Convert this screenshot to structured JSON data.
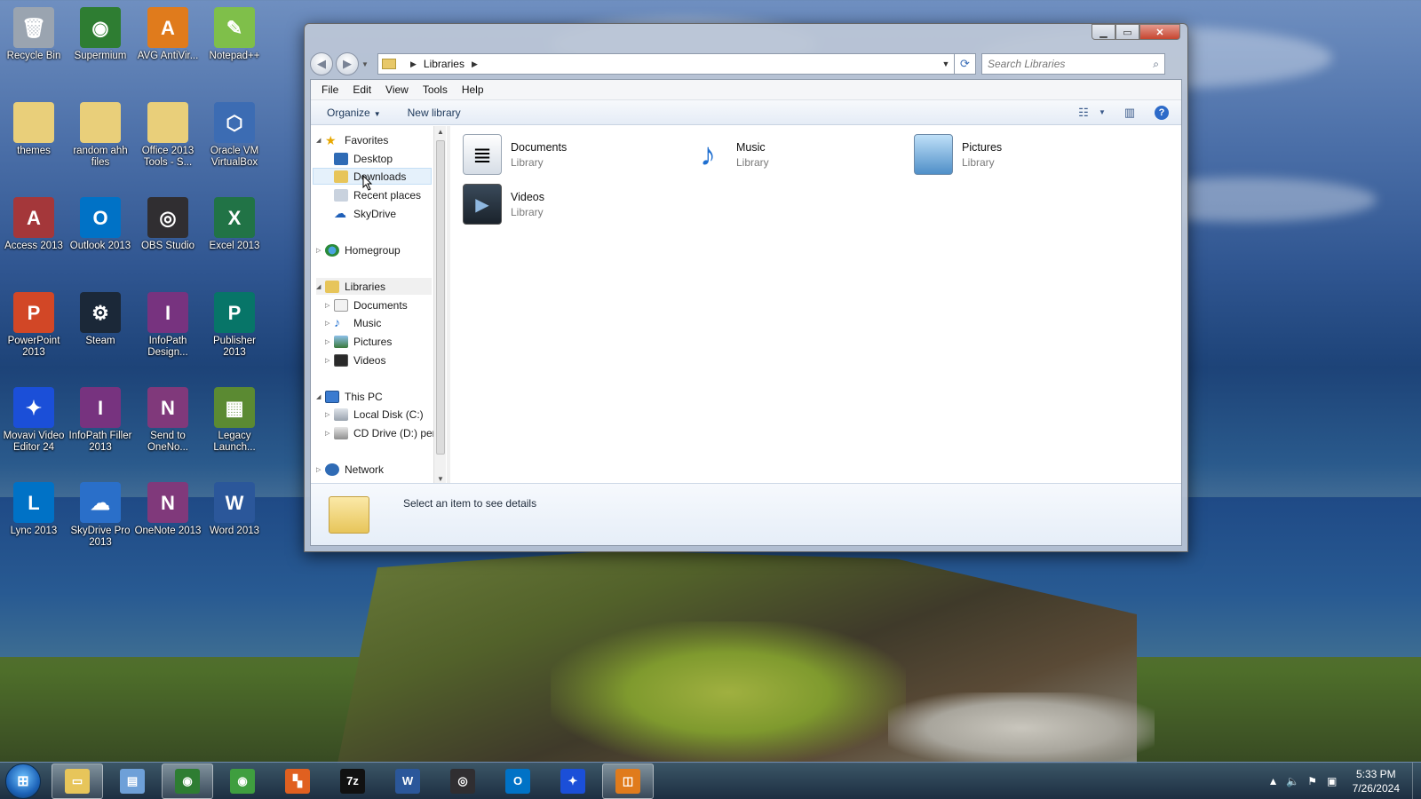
{
  "desktop": {
    "icons": [
      {
        "label": "Recycle Bin",
        "glyph": "🗑",
        "icon": "recycle-bin-icon",
        "color": "#9aa4b0"
      },
      {
        "label": "Supermium",
        "glyph": "◉",
        "icon": "browser-icon",
        "color": "#2e7d32"
      },
      {
        "label": "AVG AntiVir...",
        "glyph": "A",
        "icon": "antivirus-icon",
        "color": "#e07b1c"
      },
      {
        "label": "Notepad++",
        "glyph": "✎",
        "icon": "notepad-icon",
        "color": "#7fbf4a"
      },
      {
        "label": "themes",
        "glyph": "",
        "icon": "folder-icon",
        "color": "#e9cf7a"
      },
      {
        "label": "random ahh files",
        "glyph": "",
        "icon": "folder-icon",
        "color": "#e9cf7a"
      },
      {
        "label": "Office 2013 Tools - S...",
        "glyph": "",
        "icon": "folder-icon",
        "color": "#e9cf7a"
      },
      {
        "label": "Oracle VM VirtualBox",
        "glyph": "⬡",
        "icon": "virtualbox-icon",
        "color": "#3c6cb3"
      },
      {
        "label": "Access 2013",
        "glyph": "A",
        "icon": "access-icon",
        "color": "#a4373a"
      },
      {
        "label": "Outlook 2013",
        "glyph": "O",
        "icon": "outlook-icon",
        "color": "#0072c6"
      },
      {
        "label": "OBS Studio",
        "glyph": "◎",
        "icon": "obs-icon",
        "color": "#302e31"
      },
      {
        "label": "Excel 2013",
        "glyph": "X",
        "icon": "excel-icon",
        "color": "#217346"
      },
      {
        "label": "PowerPoint 2013",
        "glyph": "P",
        "icon": "powerpoint-icon",
        "color": "#d24726"
      },
      {
        "label": "Steam",
        "glyph": "⚙",
        "icon": "steam-icon",
        "color": "#1b2838"
      },
      {
        "label": "InfoPath Design...",
        "glyph": "I",
        "icon": "infopath-icon",
        "color": "#77337f"
      },
      {
        "label": "Publisher 2013",
        "glyph": "P",
        "icon": "publisher-icon",
        "color": "#077568"
      },
      {
        "label": "Movavi Video Editor 24",
        "glyph": "✦",
        "icon": "movavi-icon",
        "color": "#1b4fd8"
      },
      {
        "label": "InfoPath Filler 2013",
        "glyph": "I",
        "icon": "infopath-filler-icon",
        "color": "#77337f"
      },
      {
        "label": "Send to OneNo...",
        "glyph": "N",
        "icon": "send-to-onenote-icon",
        "color": "#80397b"
      },
      {
        "label": "Legacy Launch...",
        "glyph": "▦",
        "icon": "minecraft-icon",
        "color": "#5b8a32"
      },
      {
        "label": "Lync 2013",
        "glyph": "L",
        "icon": "lync-icon",
        "color": "#0072c6"
      },
      {
        "label": "SkyDrive Pro 2013",
        "glyph": "☁",
        "icon": "skydrive-pro-icon",
        "color": "#2a6fc9"
      },
      {
        "label": "OneNote 2013",
        "glyph": "N",
        "icon": "onenote-icon",
        "color": "#80397b"
      },
      {
        "label": "Word 2013",
        "glyph": "W",
        "icon": "word-icon",
        "color": "#2b579a"
      }
    ]
  },
  "window": {
    "address": {
      "location": "Libraries"
    },
    "search": {
      "placeholder": "Search Libraries"
    },
    "menu": [
      "File",
      "Edit",
      "View",
      "Tools",
      "Help"
    ],
    "toolbar": {
      "organize": "Organize",
      "new_library": "New library"
    },
    "nav": {
      "favorites": "Favorites",
      "desktop": "Desktop",
      "downloads": "Downloads",
      "recent_places": "Recent places",
      "skydrive": "SkyDrive",
      "homegroup": "Homegroup",
      "libraries": "Libraries",
      "documents": "Documents",
      "music": "Music",
      "pictures": "Pictures",
      "videos": "Videos",
      "this_pc": "This PC",
      "local_disk": "Local Disk (C:)",
      "cd_drive": "CD Drive (D:) per"
    },
    "libraries": [
      {
        "name": "Documents",
        "type": "Library"
      },
      {
        "name": "Music",
        "type": "Library"
      },
      {
        "name": "Pictures",
        "type": "Library"
      },
      {
        "name": "Videos",
        "type": "Library"
      }
    ],
    "details": {
      "text": "Select an item to see details"
    }
  },
  "taskbar": {
    "apps": [
      {
        "icon": "file-explorer-icon",
        "glyph": "▭",
        "color": "#e7c55a",
        "active": true
      },
      {
        "icon": "computer-icon",
        "glyph": "▤",
        "color": "#6ea0d8",
        "active": false
      },
      {
        "icon": "supermium-icon",
        "glyph": "◉",
        "color": "#2e7d32",
        "active": true
      },
      {
        "icon": "browser-icon",
        "glyph": "◉",
        "color": "#3f9e3f",
        "active": false
      },
      {
        "icon": "media-icon",
        "glyph": "▚",
        "color": "#e06020",
        "active": false
      },
      {
        "icon": "7zip-icon",
        "glyph": "7z",
        "color": "#111111",
        "active": false
      },
      {
        "icon": "word-icon",
        "glyph": "W",
        "color": "#2b579a",
        "active": false
      },
      {
        "icon": "obs-icon",
        "glyph": "◎",
        "color": "#302e31",
        "active": false
      },
      {
        "icon": "outlook-icon",
        "glyph": "O",
        "color": "#0072c6",
        "active": false
      },
      {
        "icon": "movavi-icon",
        "glyph": "✦",
        "color": "#1b4fd8",
        "active": false
      },
      {
        "icon": "explorer-window-icon",
        "glyph": "◫",
        "color": "#e07b1c",
        "active": true
      }
    ],
    "time": "5:33 PM",
    "date": "7/26/2024"
  }
}
